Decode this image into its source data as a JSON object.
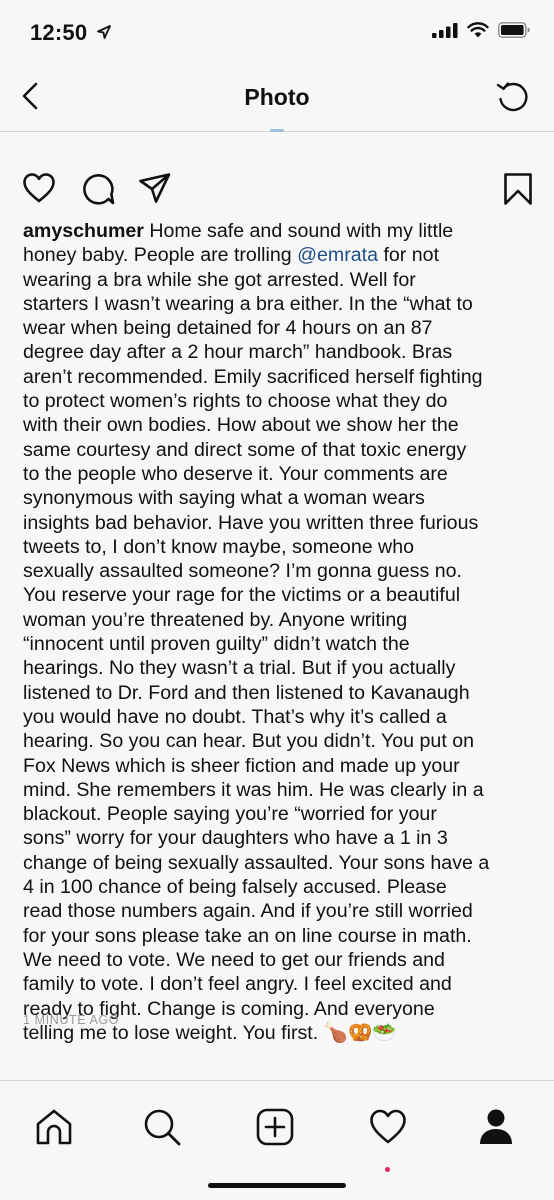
{
  "status": {
    "time": "12:50",
    "location_icon": "location-arrow-icon",
    "signal_icon": "signal-bars-icon",
    "wifi_icon": "wifi-icon",
    "battery_icon": "battery-icon"
  },
  "nav": {
    "title": "Photo",
    "back_icon": "chevron-left-icon",
    "refresh_icon": "refresh-icon"
  },
  "actions": {
    "like_icon": "heart-icon",
    "comment_icon": "comment-icon",
    "share_icon": "send-icon",
    "save_icon": "bookmark-icon"
  },
  "post": {
    "username": "amyschumer",
    "lines": [
      {
        "before": " Home safe and sound with my little",
        "mention": "",
        "after": ""
      },
      {
        "before": "honey baby. People are trolling ",
        "mention": "@emrata",
        "after": " for not"
      },
      {
        "before": "wearing a bra while she got arrested. Well for",
        "mention": "",
        "after": ""
      },
      {
        "before": "starters I wasn’t wearing a bra either. In the “what to",
        "mention": "",
        "after": ""
      },
      {
        "before": "wear when being detained  for 4 hours on an 87",
        "mention": "",
        "after": ""
      },
      {
        "before": "degree day after a 2 hour march” handbook. Bras",
        "mention": "",
        "after": ""
      },
      {
        "before": "aren’t recommended. Emily sacrificed herself fighting",
        "mention": "",
        "after": ""
      },
      {
        "before": "to protect women’s rights to choose what they do",
        "mention": "",
        "after": ""
      },
      {
        "before": "with their own bodies. How about we show her the",
        "mention": "",
        "after": ""
      },
      {
        "before": "same courtesy and direct some of that toxic energy",
        "mention": "",
        "after": ""
      },
      {
        "before": "to the people who deserve it. Your comments are",
        "mention": "",
        "after": ""
      },
      {
        "before": "synonymous with saying what a woman wears",
        "mention": "",
        "after": ""
      },
      {
        "before": "insights bad behavior. Have you written three furious",
        "mention": "",
        "after": ""
      },
      {
        "before": "tweets to, I don’t know maybe, someone who",
        "mention": "",
        "after": ""
      },
      {
        "before": "sexually assaulted someone? I’m gonna guess no.",
        "mention": "",
        "after": ""
      },
      {
        "before": "You reserve your rage for the victims or a beautiful",
        "mention": "",
        "after": ""
      },
      {
        "before": "woman you’re threatened by. Anyone writing",
        "mention": "",
        "after": ""
      },
      {
        "before": "“innocent until proven guilty” didn’t watch the",
        "mention": "",
        "after": ""
      },
      {
        "before": "hearings. No they wasn’t a trial. But if you actually",
        "mention": "",
        "after": ""
      },
      {
        "before": "listened to Dr. Ford and then listened to Kavanaugh",
        "mention": "",
        "after": ""
      },
      {
        "before": "you would have no doubt. That’s why it’s called a",
        "mention": "",
        "after": ""
      },
      {
        "before": "hearing. So you can hear. But you didn’t. You put on",
        "mention": "",
        "after": ""
      },
      {
        "before": "Fox News which is sheer fiction and made up your",
        "mention": "",
        "after": ""
      },
      {
        "before": "mind. She remembers it was him. He was clearly in a",
        "mention": "",
        "after": ""
      },
      {
        "before": "blackout. People saying you’re “worried for your",
        "mention": "",
        "after": ""
      },
      {
        "before": "sons” worry for your daughters who have a 1 in 3",
        "mention": "",
        "after": ""
      },
      {
        "before": "change of being sexually assaulted. Your sons have a",
        "mention": "",
        "after": ""
      },
      {
        "before": "4 in 100 chance of being falsely accused. Please",
        "mention": "",
        "after": ""
      },
      {
        "before": "read those numbers again. And if you’re still worried",
        "mention": "",
        "after": ""
      },
      {
        "before": "for your sons please take an on line course in math.",
        "mention": "",
        "after": ""
      },
      {
        "before": "We need to vote. We need to get our friends and",
        "mention": "",
        "after": ""
      },
      {
        "before": "family to vote. I don’t feel angry. I feel excited and",
        "mention": "",
        "after": ""
      },
      {
        "before": "ready to fight. Change is coming. And everyone",
        "mention": "",
        "after": ""
      },
      {
        "before": "telling me to lose weight. You first. 🍗🥨🥗",
        "mention": "",
        "after": ""
      }
    ],
    "timestamp": "1 MINUTE AGO"
  },
  "tabbar": {
    "home_icon": "home-icon",
    "search_icon": "search-icon",
    "add_icon": "add-post-icon",
    "activity_icon": "heart-icon",
    "profile_icon": "profile-icon"
  },
  "colors": {
    "mention": "#1f4f87",
    "background": "#f7f7f7",
    "notification_dot": "#e0245e"
  }
}
